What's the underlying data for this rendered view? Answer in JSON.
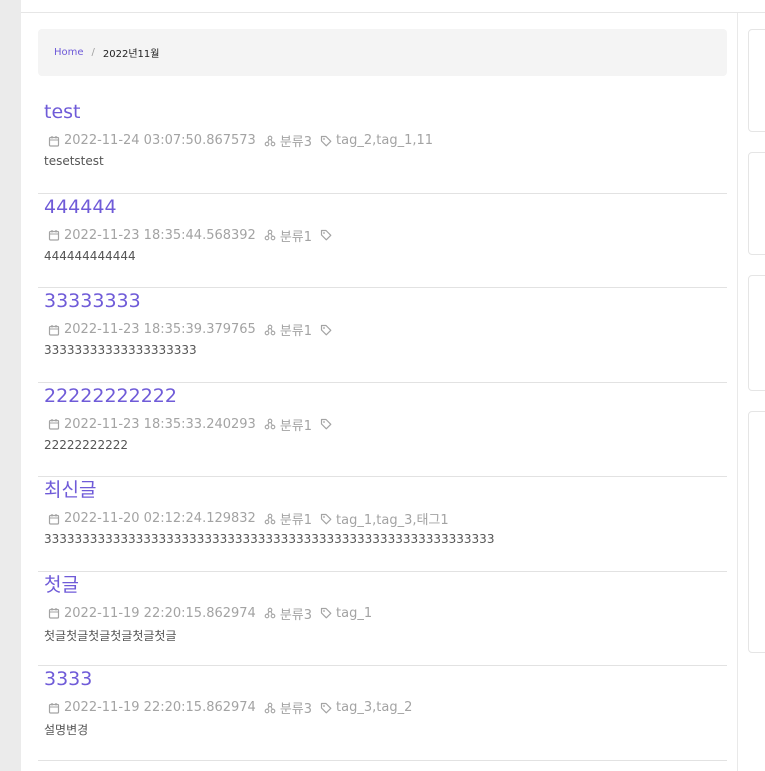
{
  "breadcrumb": {
    "home": "Home",
    "separator": "/",
    "current": "2022년11월"
  },
  "posts": [
    {
      "title": "test",
      "date": "2022-11-24 03:07:50.867573",
      "category": "분류3",
      "tags": "tag_2,tag_1,11",
      "description": "tesetstest"
    },
    {
      "title": "444444",
      "date": "2022-11-23 18:35:44.568392",
      "category": "분류1",
      "tags": "",
      "description": "444444444444"
    },
    {
      "title": "33333333",
      "date": "2022-11-23 18:35:39.379765",
      "category": "분류1",
      "tags": "",
      "description": "33333333333333333333"
    },
    {
      "title": "22222222222",
      "date": "2022-11-23 18:35:33.240293",
      "category": "분류1",
      "tags": "",
      "description": "22222222222"
    },
    {
      "title": "최신글",
      "date": "2022-11-20 02:12:24.129832",
      "category": "분류1",
      "tags": "tag_1,tag_3,태그1",
      "description": "33333333333333333333333333333333333333333333333333333333333"
    },
    {
      "title": "첫글",
      "date": "2022-11-19 22:20:15.862974",
      "category": "분류3",
      "tags": "tag_1",
      "description": "첫글첫글첫글첫글첫글첫글"
    },
    {
      "title": "3333",
      "date": "2022-11-19 22:20:15.862974",
      "category": "분류3",
      "tags": "tag_3,tag_2",
      "description": "설명변경"
    }
  ]
}
